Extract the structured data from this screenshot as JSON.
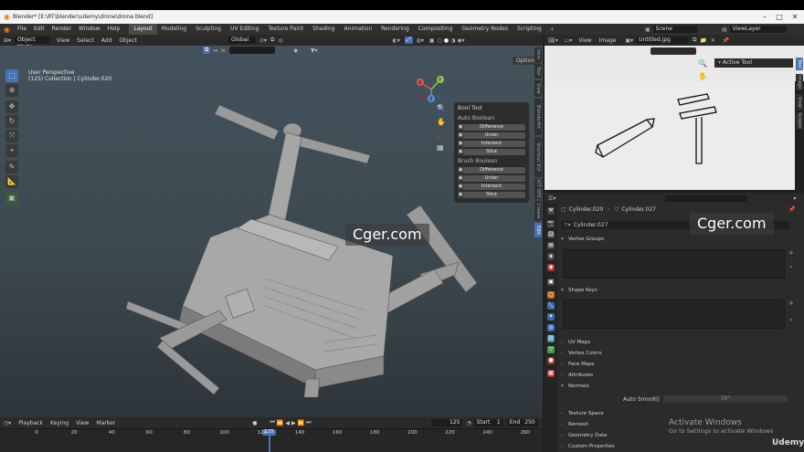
{
  "window": {
    "title": "Blender* [E:\\RT\\blender\\udemy\\drone\\drone.blend]",
    "min_icon": "minimize-icon",
    "max_icon": "maximize-icon",
    "close_icon": "close-icon"
  },
  "menu": [
    "File",
    "Edit",
    "Render",
    "Window",
    "Help"
  ],
  "workspaces": [
    {
      "label": "Layout",
      "active": true
    },
    {
      "label": "Modeling"
    },
    {
      "label": "Sculpting"
    },
    {
      "label": "UV Editing"
    },
    {
      "label": "Texture Paint"
    },
    {
      "label": "Shading"
    },
    {
      "label": "Animation"
    },
    {
      "label": "Rendering"
    },
    {
      "label": "Compositing"
    },
    {
      "label": "Geometry Nodes"
    },
    {
      "label": "Scripting"
    }
  ],
  "scene": {
    "label": "Scene",
    "view_layer": "ViewLayer"
  },
  "viewport": {
    "mode": "Object Mode",
    "menus": [
      "View",
      "Select",
      "Add",
      "Object"
    ],
    "orientation": "Global",
    "options": "Options",
    "overlay_title": "User Perspective",
    "overlay_sub": "(125) Collection | Cylinder.020"
  },
  "bool_tool": {
    "title": "Bool Tool",
    "auto_label": "Auto Boolean",
    "auto_buttons": [
      "Difference",
      "Union",
      "Intersect",
      "Slice"
    ],
    "brush_label": "Brush Boolean",
    "brush_buttons": [
      "Difference",
      "Union",
      "Intersect",
      "Slice"
    ]
  },
  "sidebar_tabs": [
    "Item",
    "Tool",
    "View",
    "BlenderKit",
    "Shortcut VUr",
    "KIT OPS",
    "Create",
    "Edit"
  ],
  "image_editor": {
    "menus": [
      "View",
      "Image"
    ],
    "image_name": "Untitled.jpg",
    "active_tool": "Active Tool",
    "tabs": [
      "Tool",
      "Image",
      "View",
      "Scopes"
    ]
  },
  "properties": {
    "breadcrumb": [
      "Cylinder.020",
      "Cylinder.027"
    ],
    "mesh_name": "Cylinder.027",
    "sections": [
      "Vertex Groups",
      "Shape Keys",
      "UV Maps",
      "Vertex Colors",
      "Face Maps",
      "Attributes",
      "Normals",
      "Texture Space",
      "Remesh",
      "Geometry Data",
      "Custom Properties"
    ],
    "auto_smooth_label": "Auto Smooth",
    "auto_smooth_value": "30°"
  },
  "timeline": {
    "menus": [
      "Playback",
      "Keying",
      "View",
      "Marker"
    ],
    "current_frame": "125",
    "start_label": "Start",
    "start_value": "1",
    "end_label": "End",
    "end_value": "250",
    "ticks": [
      "0",
      "20",
      "40",
      "60",
      "80",
      "100",
      "120",
      "140",
      "160",
      "180",
      "200",
      "220",
      "240",
      "260"
    ]
  },
  "watermarks": [
    "Cger.com",
    "Cger.com"
  ],
  "windows_notice": {
    "title": "Activate Windows",
    "sub": "Go to Settings to activate Windows"
  },
  "brand": "Udemy"
}
